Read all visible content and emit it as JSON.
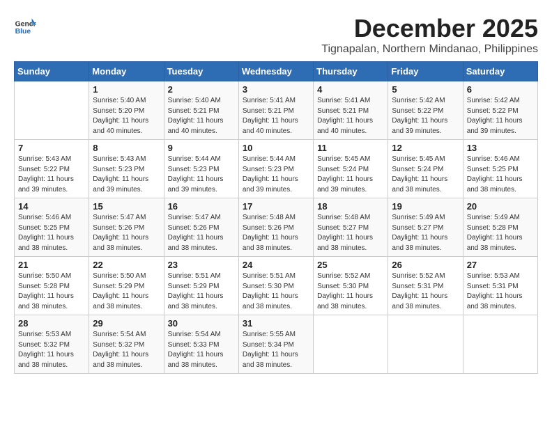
{
  "header": {
    "logo_general": "General",
    "logo_blue": "Blue",
    "month_title": "December 2025",
    "location": "Tignapalan, Northern Mindanao, Philippines"
  },
  "weekdays": [
    "Sunday",
    "Monday",
    "Tuesday",
    "Wednesday",
    "Thursday",
    "Friday",
    "Saturday"
  ],
  "weeks": [
    [
      {
        "day": "",
        "info": ""
      },
      {
        "day": "1",
        "info": "Sunrise: 5:40 AM\nSunset: 5:20 PM\nDaylight: 11 hours\nand 40 minutes."
      },
      {
        "day": "2",
        "info": "Sunrise: 5:40 AM\nSunset: 5:21 PM\nDaylight: 11 hours\nand 40 minutes."
      },
      {
        "day": "3",
        "info": "Sunrise: 5:41 AM\nSunset: 5:21 PM\nDaylight: 11 hours\nand 40 minutes."
      },
      {
        "day": "4",
        "info": "Sunrise: 5:41 AM\nSunset: 5:21 PM\nDaylight: 11 hours\nand 40 minutes."
      },
      {
        "day": "5",
        "info": "Sunrise: 5:42 AM\nSunset: 5:22 PM\nDaylight: 11 hours\nand 39 minutes."
      },
      {
        "day": "6",
        "info": "Sunrise: 5:42 AM\nSunset: 5:22 PM\nDaylight: 11 hours\nand 39 minutes."
      }
    ],
    [
      {
        "day": "7",
        "info": "Sunrise: 5:43 AM\nSunset: 5:22 PM\nDaylight: 11 hours\nand 39 minutes."
      },
      {
        "day": "8",
        "info": "Sunrise: 5:43 AM\nSunset: 5:23 PM\nDaylight: 11 hours\nand 39 minutes."
      },
      {
        "day": "9",
        "info": "Sunrise: 5:44 AM\nSunset: 5:23 PM\nDaylight: 11 hours\nand 39 minutes."
      },
      {
        "day": "10",
        "info": "Sunrise: 5:44 AM\nSunset: 5:23 PM\nDaylight: 11 hours\nand 39 minutes."
      },
      {
        "day": "11",
        "info": "Sunrise: 5:45 AM\nSunset: 5:24 PM\nDaylight: 11 hours\nand 39 minutes."
      },
      {
        "day": "12",
        "info": "Sunrise: 5:45 AM\nSunset: 5:24 PM\nDaylight: 11 hours\nand 38 minutes."
      },
      {
        "day": "13",
        "info": "Sunrise: 5:46 AM\nSunset: 5:25 PM\nDaylight: 11 hours\nand 38 minutes."
      }
    ],
    [
      {
        "day": "14",
        "info": "Sunrise: 5:46 AM\nSunset: 5:25 PM\nDaylight: 11 hours\nand 38 minutes."
      },
      {
        "day": "15",
        "info": "Sunrise: 5:47 AM\nSunset: 5:26 PM\nDaylight: 11 hours\nand 38 minutes."
      },
      {
        "day": "16",
        "info": "Sunrise: 5:47 AM\nSunset: 5:26 PM\nDaylight: 11 hours\nand 38 minutes."
      },
      {
        "day": "17",
        "info": "Sunrise: 5:48 AM\nSunset: 5:26 PM\nDaylight: 11 hours\nand 38 minutes."
      },
      {
        "day": "18",
        "info": "Sunrise: 5:48 AM\nSunset: 5:27 PM\nDaylight: 11 hours\nand 38 minutes."
      },
      {
        "day": "19",
        "info": "Sunrise: 5:49 AM\nSunset: 5:27 PM\nDaylight: 11 hours\nand 38 minutes."
      },
      {
        "day": "20",
        "info": "Sunrise: 5:49 AM\nSunset: 5:28 PM\nDaylight: 11 hours\nand 38 minutes."
      }
    ],
    [
      {
        "day": "21",
        "info": "Sunrise: 5:50 AM\nSunset: 5:28 PM\nDaylight: 11 hours\nand 38 minutes."
      },
      {
        "day": "22",
        "info": "Sunrise: 5:50 AM\nSunset: 5:29 PM\nDaylight: 11 hours\nand 38 minutes."
      },
      {
        "day": "23",
        "info": "Sunrise: 5:51 AM\nSunset: 5:29 PM\nDaylight: 11 hours\nand 38 minutes."
      },
      {
        "day": "24",
        "info": "Sunrise: 5:51 AM\nSunset: 5:30 PM\nDaylight: 11 hours\nand 38 minutes."
      },
      {
        "day": "25",
        "info": "Sunrise: 5:52 AM\nSunset: 5:30 PM\nDaylight: 11 hours\nand 38 minutes."
      },
      {
        "day": "26",
        "info": "Sunrise: 5:52 AM\nSunset: 5:31 PM\nDaylight: 11 hours\nand 38 minutes."
      },
      {
        "day": "27",
        "info": "Sunrise: 5:53 AM\nSunset: 5:31 PM\nDaylight: 11 hours\nand 38 minutes."
      }
    ],
    [
      {
        "day": "28",
        "info": "Sunrise: 5:53 AM\nSunset: 5:32 PM\nDaylight: 11 hours\nand 38 minutes."
      },
      {
        "day": "29",
        "info": "Sunrise: 5:54 AM\nSunset: 5:32 PM\nDaylight: 11 hours\nand 38 minutes."
      },
      {
        "day": "30",
        "info": "Sunrise: 5:54 AM\nSunset: 5:33 PM\nDaylight: 11 hours\nand 38 minutes."
      },
      {
        "day": "31",
        "info": "Sunrise: 5:55 AM\nSunset: 5:34 PM\nDaylight: 11 hours\nand 38 minutes."
      },
      {
        "day": "",
        "info": ""
      },
      {
        "day": "",
        "info": ""
      },
      {
        "day": "",
        "info": ""
      }
    ]
  ]
}
